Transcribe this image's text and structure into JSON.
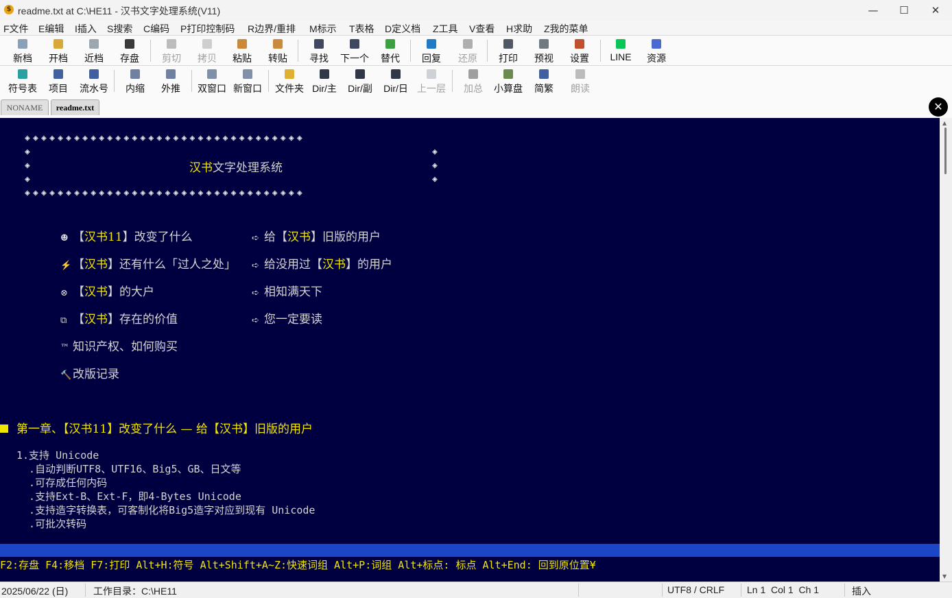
{
  "window": {
    "title": "readme.txt at C:\\HE11 - 汉书文字处理系统(V11)",
    "app_icon": "coin-icon",
    "minimize": "—",
    "maximize": "☐",
    "close": "✕"
  },
  "menu": [
    "F文件",
    "E编辑",
    "I插入",
    "S搜索",
    "C编码",
    "P打印控制码",
    "R边界/重排",
    "M标示",
    "T表格",
    "D定义档",
    "Z工具",
    "V查看",
    "H求助",
    "Z我的菜单"
  ],
  "toolbar1": [
    {
      "label": "新档",
      "icon": "new-doc-icon",
      "color": "#8aa0b8",
      "enabled": true
    },
    {
      "label": "开档",
      "icon": "open-doc-icon",
      "color": "#d9a83a",
      "enabled": true
    },
    {
      "label": "近档",
      "icon": "recent-doc-icon",
      "color": "#9aa6b0",
      "enabled": true
    },
    {
      "label": "存盘",
      "icon": "save-icon",
      "color": "#3a3a3a",
      "enabled": true
    },
    {
      "label": "剪切",
      "icon": "cut-icon",
      "color": "#707070",
      "enabled": false
    },
    {
      "label": "拷贝",
      "icon": "copy-icon",
      "color": "#9a9a9a",
      "enabled": false
    },
    {
      "label": "粘贴",
      "icon": "paste-icon",
      "color": "#c98a3a",
      "enabled": true
    },
    {
      "label": "转贴",
      "icon": "repaste-icon",
      "color": "#c98a3a",
      "enabled": true
    },
    {
      "label": "寻找",
      "icon": "find-icon",
      "color": "#404860",
      "enabled": true
    },
    {
      "label": "下一个",
      "icon": "find-next-icon",
      "color": "#404860",
      "enabled": true
    },
    {
      "label": "替代",
      "icon": "replace-icon",
      "color": "#3aa040",
      "enabled": true
    },
    {
      "label": "回复",
      "icon": "undo-icon",
      "color": "#1f7ac8",
      "enabled": true
    },
    {
      "label": "还原",
      "icon": "redo-icon",
      "color": "#555555",
      "enabled": false
    },
    {
      "label": "打印",
      "icon": "print-icon",
      "color": "#505866",
      "enabled": true
    },
    {
      "label": "预视",
      "icon": "preview-icon",
      "color": "#707880",
      "enabled": true
    },
    {
      "label": "设置",
      "icon": "settings-icon",
      "color": "#c05030",
      "enabled": true
    },
    {
      "label": "LINE",
      "icon": "line-app-icon",
      "color": "#06c755",
      "enabled": true
    },
    {
      "label": "资源",
      "icon": "resources-icon",
      "color": "#4a6ad0",
      "enabled": true
    }
  ],
  "toolbar2": [
    {
      "label": "符号表",
      "icon": "symbol-table-icon",
      "color": "#2aa0a0",
      "enabled": true
    },
    {
      "label": "项目",
      "icon": "bullet-list-icon",
      "color": "#4060a0",
      "enabled": true
    },
    {
      "label": "流水号",
      "icon": "numbered-list-icon",
      "color": "#4060a0",
      "enabled": true
    },
    {
      "label": "内缩",
      "icon": "indent-icon",
      "color": "#7080a0",
      "enabled": true
    },
    {
      "label": "外推",
      "icon": "outdent-icon",
      "color": "#7080a0",
      "enabled": true
    },
    {
      "label": "双窗口",
      "icon": "split-window-icon",
      "color": "#8090a8",
      "enabled": true
    },
    {
      "label": "新窗口",
      "icon": "new-window-icon",
      "color": "#8090a8",
      "enabled": true
    },
    {
      "label": "文件夹",
      "icon": "folder-icon",
      "color": "#e0b030",
      "enabled": true
    },
    {
      "label": "Dir/主",
      "icon": "dir-main-icon",
      "color": "#303848",
      "enabled": true
    },
    {
      "label": "Dir/副",
      "icon": "dir-sub-icon",
      "color": "#303848",
      "enabled": true
    },
    {
      "label": "Dir/日",
      "icon": "dir-day-icon",
      "color": "#303848",
      "enabled": true
    },
    {
      "label": "上一层",
      "icon": "up-level-icon",
      "color": "#9aa0a8",
      "enabled": false
    },
    {
      "label": "加总",
      "icon": "sum-icon",
      "color": "#303030",
      "enabled": false
    },
    {
      "label": "小算盘",
      "icon": "calculator-icon",
      "color": "#6a8a50",
      "enabled": true
    },
    {
      "label": "简繁",
      "icon": "simp-trad-icon",
      "color": "#4060a0",
      "enabled": true
    },
    {
      "label": "朗读",
      "icon": "read-aloud-icon",
      "color": "#707070",
      "enabled": false
    }
  ],
  "tabs": [
    "NONAME",
    "readme.txt"
  ],
  "close_document": "✕",
  "document": {
    "border_glyph": "◈",
    "frame_title_yellow": "汉书",
    "frame_title_white": "文字处理系统",
    "left_menu": [
      {
        "bullet": "☻",
        "pre": "【",
        "yellow": "汉书11",
        "post": "】改变了什么"
      },
      {
        "bullet": "⚡",
        "pre": "【",
        "yellow": "汉书",
        "post": "】还有什么「过人之处」"
      },
      {
        "bullet": "⊗",
        "pre": "【",
        "yellow": "汉书",
        "post": "】的大户"
      },
      {
        "bullet": "⧉",
        "pre": "【",
        "yellow": "汉书",
        "post": "】存在的价值"
      },
      {
        "bullet": "™",
        "pre": "知识产权、如何购买",
        "yellow": "",
        "post": ""
      },
      {
        "bullet": "🔨",
        "pre": "改版记录",
        "yellow": "",
        "post": ""
      }
    ],
    "right_menu": [
      {
        "bullet": "➪",
        "pre": "给【",
        "yellow": "汉书",
        "post": "】旧版的用户"
      },
      {
        "bullet": "➪",
        "pre": "给没用过【",
        "yellow": "汉书",
        "post": "】的用户"
      },
      {
        "bullet": "➪",
        "pre": "相知满天下",
        "yellow": "",
        "post": ""
      },
      {
        "bullet": "➪",
        "pre": "您一定要读",
        "yellow": "",
        "post": ""
      }
    ],
    "chapter_title": "第一章、【汉书11】改变了什么 — 给【汉书】旧版的用户",
    "body_lines": [
      "1.支持 Unicode",
      "  .自动判断UTF8、UTF16、Big5、GB、日文等",
      "  .可存成任何内码",
      "  .支持Ext-B、Ext-F，即4-Bytes Unicode",
      "  .支持造字转换表，可客制化将Big5造字对应到现有 Unicode",
      "  .可批次转码"
    ]
  },
  "hint_line": "F2:存盘 F4:移档 F7:打印 Alt+H:符号 Alt+Shift+A~Z:快速词组 Alt+P:词组 Alt+标点: 标点 Alt+End: 回到原位置¥",
  "status": {
    "date": "2025/06/22 (日)",
    "workdir": "工作目录：C:\\HE11",
    "encoding": "UTF8 / CRLF",
    "position": "Ln 1  Col 1  Ch 1",
    "mode": "插入"
  }
}
